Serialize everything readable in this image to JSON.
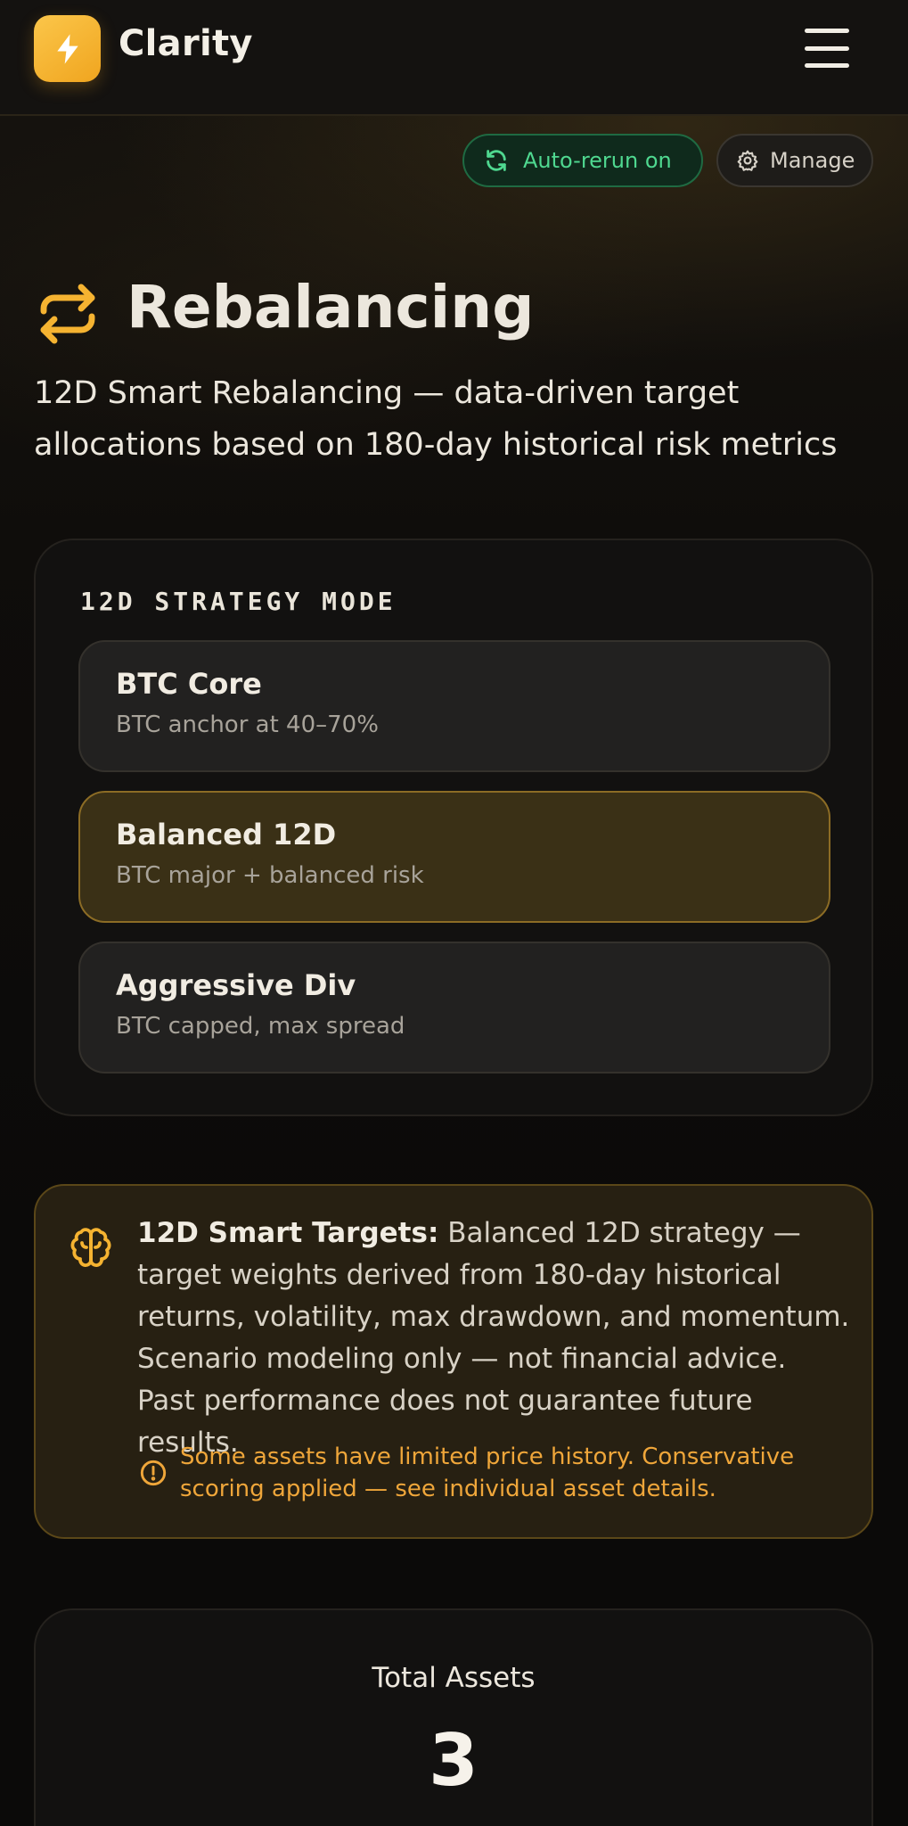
{
  "app": {
    "name": "Clarity",
    "logo_icon": "lightning-bolt-icon",
    "accent_color": "#f5b331"
  },
  "header": {
    "menu_icon": "hamburger-menu-icon"
  },
  "toolbar": {
    "auto_rerun_label": "Auto-rerun on",
    "auto_rerun_icon": "refresh-icon",
    "auto_rerun_color": "#4fd890",
    "manage_label": "Manage",
    "manage_icon": "gear-icon"
  },
  "page": {
    "title": "Rebalancing",
    "title_icon": "repeat-arrows-icon",
    "subtitle": "12D Smart Rebalancing — data-driven target allocations based on 180-day historical risk metrics"
  },
  "strategy": {
    "section_label": "12D STRATEGY MODE",
    "options": [
      {
        "title": "BTC Core",
        "description": "BTC anchor at 40–70%",
        "selected": false
      },
      {
        "title": "Balanced 12D",
        "description": "BTC major + balanced risk",
        "selected": true
      },
      {
        "title": "Aggressive Div",
        "description": "BTC capped, max spread",
        "selected": false
      }
    ]
  },
  "info": {
    "icon": "brain-icon",
    "heading": "12D Smart Targets:",
    "body": "Balanced 12D strategy — target weights derived from 180-day historical returns, volatility, max drawdown, and momentum. Scenario modeling only — not financial advice. Past performance does not guarantee future results.",
    "warning_icon": "alert-circle-icon",
    "warning": "Some assets have limited price history. Conservative scoring applied — see individual asset details."
  },
  "stats": {
    "total_assets_label": "Total Assets",
    "total_assets_value": "3"
  }
}
